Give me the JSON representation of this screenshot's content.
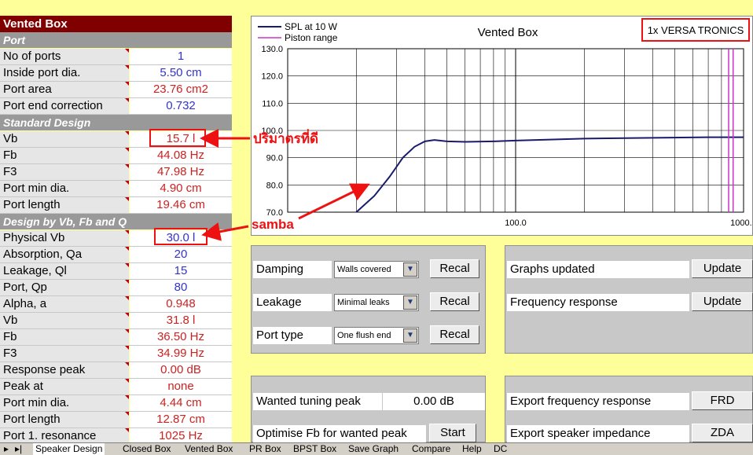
{
  "left": {
    "title": "Vented Box",
    "sections": [
      {
        "label": "Port"
      },
      {
        "label": "Standard Design"
      },
      {
        "label": "Design by Vb, Fb and Q"
      }
    ],
    "rows": [
      {
        "label": "No of ports",
        "value": "1"
      },
      {
        "label": "Inside port dia.",
        "value": "5.50  cm"
      },
      {
        "label": "Port area",
        "value": "23.76  cm2"
      },
      {
        "label": "Port end correction",
        "value": "0.732"
      },
      {
        "label": "Vb",
        "value": "15.7  l"
      },
      {
        "label": "Fb",
        "value": "44.08  Hz"
      },
      {
        "label": "F3",
        "value": "47.98  Hz"
      },
      {
        "label": "Port min dia.",
        "value": "4.90  cm"
      },
      {
        "label": "Port length",
        "value": "19.46  cm"
      },
      {
        "label": "Physical Vb",
        "value": "30.0  l"
      },
      {
        "label": "Absorption, Qa",
        "value": "20"
      },
      {
        "label": "Leakage, Ql",
        "value": "15"
      },
      {
        "label": "Port, Qp",
        "value": "80"
      },
      {
        "label": "Alpha, a",
        "value": "0.948"
      },
      {
        "label": "Vb",
        "value": "31.8  l"
      },
      {
        "label": "Fb",
        "value": "36.50  Hz"
      },
      {
        "label": "F3",
        "value": "34.99  Hz"
      },
      {
        "label": "Response peak",
        "value": "0.00  dB"
      },
      {
        "label": "Peak at",
        "value": "none"
      },
      {
        "label": "Port min dia.",
        "value": "4.44  cm"
      },
      {
        "label": "Port length",
        "value": "12.87  cm"
      },
      {
        "label": "Port 1. resonance",
        "value": "1025  Hz"
      }
    ]
  },
  "annotations": {
    "thai_label": "ปริมาตรที่ดี",
    "samba_label": "samba"
  },
  "chart_data": {
    "type": "line",
    "title": "Vented Box",
    "badge": "1x VERSA TRONICS",
    "legend": [
      "SPL at 10 W",
      "Piston range"
    ],
    "legend_position": "top-left",
    "y_ticks": [
      "130.0",
      "120.0",
      "110.0",
      "100.0",
      "90.0",
      "80.0",
      "70.0"
    ],
    "x_tick_labels": [
      "100.0",
      "1000.0"
    ],
    "ylim": [
      70,
      130
    ],
    "xlim": [
      10,
      1000
    ],
    "x_scale": "log",
    "grid": true,
    "series": [
      {
        "name": "SPL at 10 W",
        "color": "#1a1a6e",
        "x": [
          20,
          24,
          28,
          32,
          36,
          40,
          44,
          50,
          60,
          80,
          100,
          200,
          400,
          700,
          1000
        ],
        "y": [
          70,
          76,
          83,
          90,
          94,
          96,
          96.5,
          96,
          95.8,
          96,
          96.3,
          97,
          97.3,
          97.5,
          97.5
        ]
      },
      {
        "name": "Piston range",
        "color": "#cc33cc",
        "x": [
          860,
          900
        ],
        "y": [
          70,
          130
        ]
      }
    ]
  },
  "panels": {
    "damping": {
      "label": "Damping",
      "select": "Walls covered",
      "button": "Recal"
    },
    "leakage": {
      "label": "Leakage",
      "select": "Minimal leaks",
      "button": "Recal"
    },
    "port_type": {
      "label": "Port type",
      "select": "One flush end",
      "button": "Recal"
    },
    "graphs_updated": {
      "label": "Graphs updated",
      "button": "Update"
    },
    "freq_response": {
      "label": "Frequency response",
      "button": "Update"
    },
    "wanted_peak": {
      "label": "Wanted tuning peak",
      "value": "0.00  dB"
    },
    "optimise": {
      "label": "Optimise Fb for wanted peak",
      "button": "Start"
    },
    "export_freq": {
      "label": "Export frequency response",
      "button": "FRD"
    },
    "export_imp": {
      "label": "Export speaker impedance",
      "button": "ZDA"
    }
  },
  "tabs": [
    "Speaker Design",
    "Closed Box",
    "Vented Box",
    "PR Box",
    "BPST Box",
    "Save Graph",
    "Compare",
    "Help",
    "DC"
  ]
}
